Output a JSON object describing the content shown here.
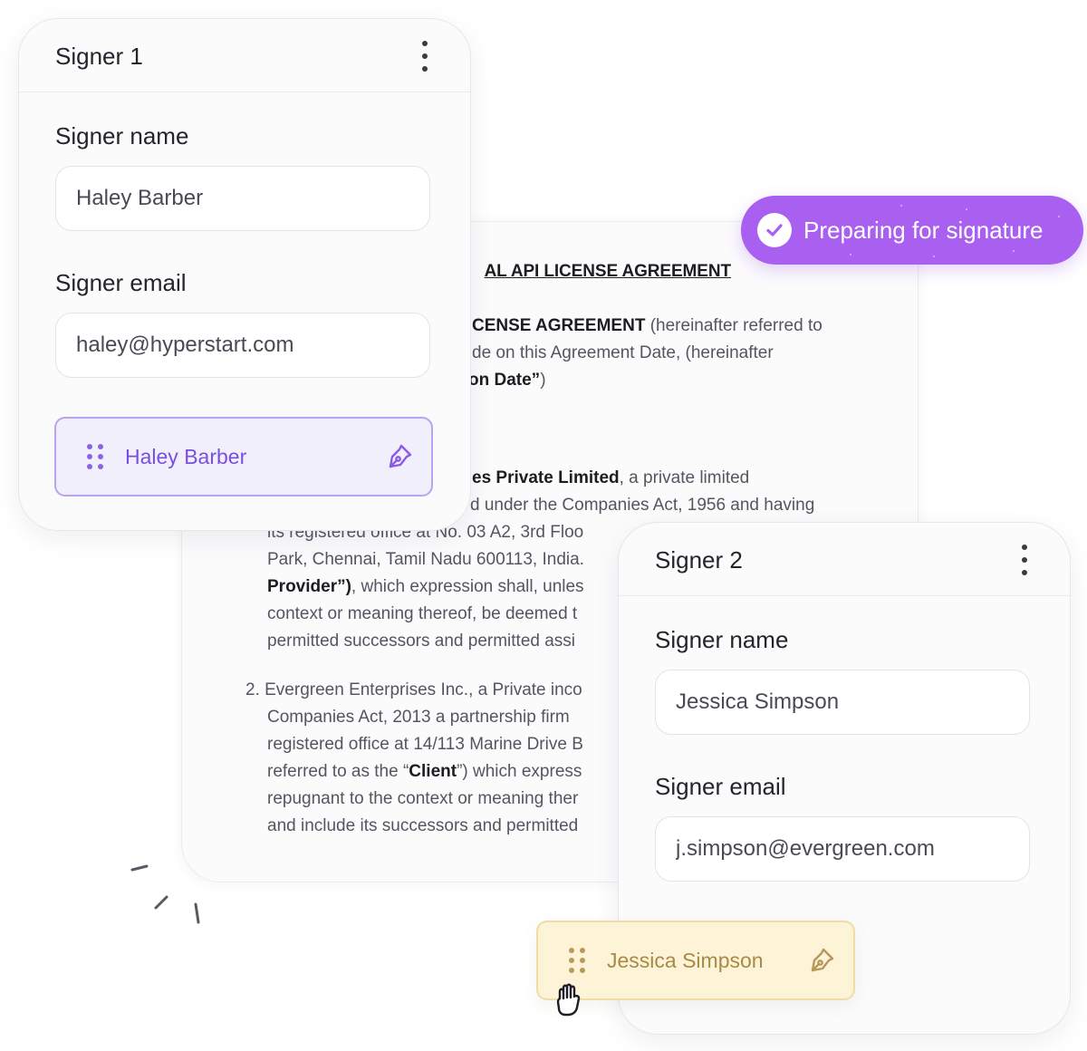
{
  "status_badge": {
    "text": "Preparing for signature",
    "color": "#a95ff0"
  },
  "document": {
    "title_fragment": "AL API LICENSE AGREEMENT",
    "lines": [
      {
        "parts": [
          {
            "text": "CENSE AGREEMENT",
            "bold": true
          },
          {
            "text": " (hereinafter referred to",
            "bold": false
          }
        ]
      },
      {
        "parts": [
          {
            "text": "de on this Agreement Date, (hereinafter",
            "bold": false
          }
        ]
      },
      {
        "parts": [
          {
            "text": "on Date”",
            "bold": true
          },
          {
            "text": ")",
            "bold": false
          }
        ]
      },
      {
        "parts": [
          {
            "text": "es Private Limited",
            "bold": true
          },
          {
            "text": ", a private limited",
            "bold": false
          }
        ]
      },
      {
        "parts": [
          {
            "text": "d under the Companies Act, 1956 and having",
            "bold": false
          }
        ]
      },
      {
        "parts": [
          {
            "text": "its registered office at No. 03 A2, 3rd Floo",
            "bold": false
          }
        ]
      },
      {
        "parts": [
          {
            "text": "Park, Chennai, Tamil Nadu 600113, India.",
            "bold": false
          }
        ]
      },
      {
        "parts": [
          {
            "text": "Provider”)",
            "bold": true
          },
          {
            "text": ", which expression shall, unles",
            "bold": false
          }
        ]
      },
      {
        "parts": [
          {
            "text": "context or meaning thereof, be deemed t",
            "bold": false
          }
        ]
      },
      {
        "parts": [
          {
            "text": "permitted successors and permitted assi",
            "bold": false
          }
        ]
      },
      {
        "parts": [
          {
            "text": "2.  Evergreen Enterprises Inc., a Private inco",
            "bold": false
          }
        ]
      },
      {
        "parts": [
          {
            "text": "Companies Act, 2013 a partnership   firm",
            "bold": false
          }
        ]
      },
      {
        "parts": [
          {
            "text": "registered office at 14/113 Marine Drive B",
            "bold": false
          }
        ]
      },
      {
        "parts": [
          {
            "text": "referred to as the “",
            "bold": false
          },
          {
            "text": "Client",
            "bold": true
          },
          {
            "text": "”) which express",
            "bold": false
          }
        ]
      },
      {
        "parts": [
          {
            "text": "repugnant to the context or meaning ther",
            "bold": false
          }
        ]
      },
      {
        "parts": [
          {
            "text": "and include its successors and permitted",
            "bold": false
          }
        ]
      }
    ]
  },
  "signer1": {
    "title": "Signer 1",
    "name_label": "Signer name",
    "name_value": "Haley Barber",
    "email_label": "Signer email",
    "email_value": "haley@hyperstart.com",
    "chip_name": "Haley Barber",
    "chip_color": "#7a4fe0"
  },
  "signer2": {
    "title": "Signer 2",
    "name_label": "Signer name",
    "name_value": "Jessica Simpson",
    "email_label": "Signer email",
    "email_value": "j.simpson@evergreen.com",
    "chip_name": "Jessica Simpson",
    "chip_color": "#a88a46"
  },
  "icons": [
    "kebab-menu-icon",
    "drag-grip-icon",
    "pen-nib-icon",
    "check-circle-icon",
    "hand-grab-cursor-icon"
  ]
}
